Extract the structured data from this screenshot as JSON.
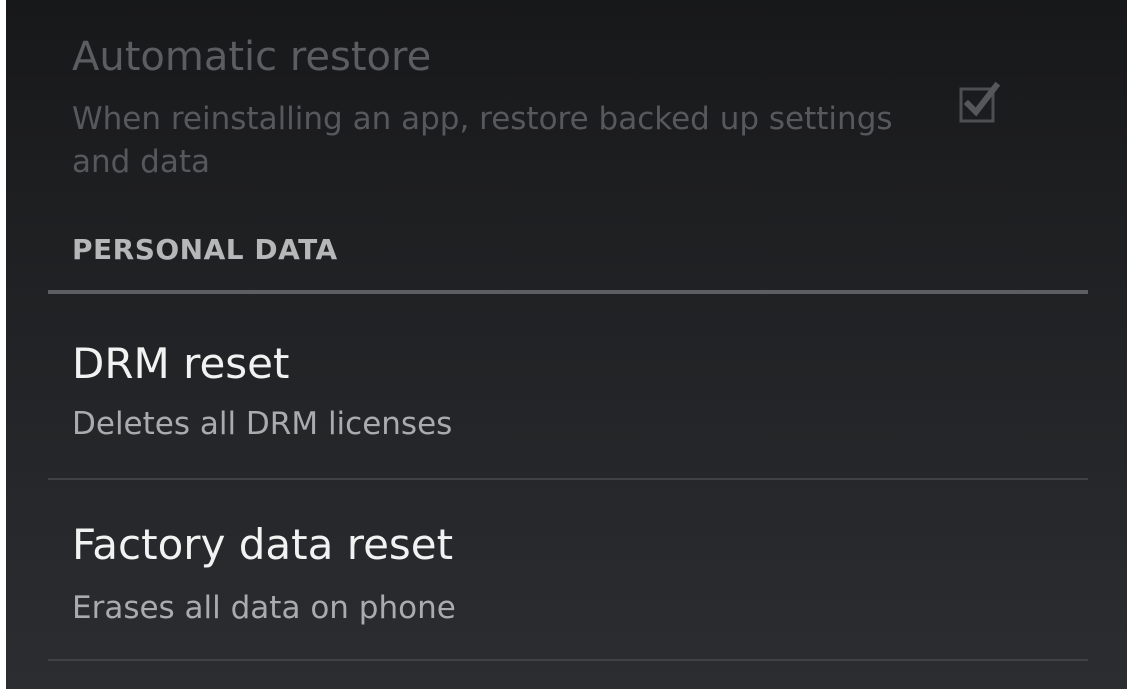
{
  "backup": {
    "automatic_restore": {
      "title": "Automatic restore",
      "summary": "When reinstalling an app, restore backed up settings and data",
      "checked": true,
      "enabled": false
    }
  },
  "personal_data": {
    "header": "PERSONAL DATA",
    "items": [
      {
        "title": "DRM reset",
        "summary": "Deletes all DRM licenses"
      },
      {
        "title": "Factory data reset",
        "summary": "Erases all data on phone"
      }
    ]
  },
  "icons": {
    "checkbox": "checkbox-checked-icon"
  }
}
